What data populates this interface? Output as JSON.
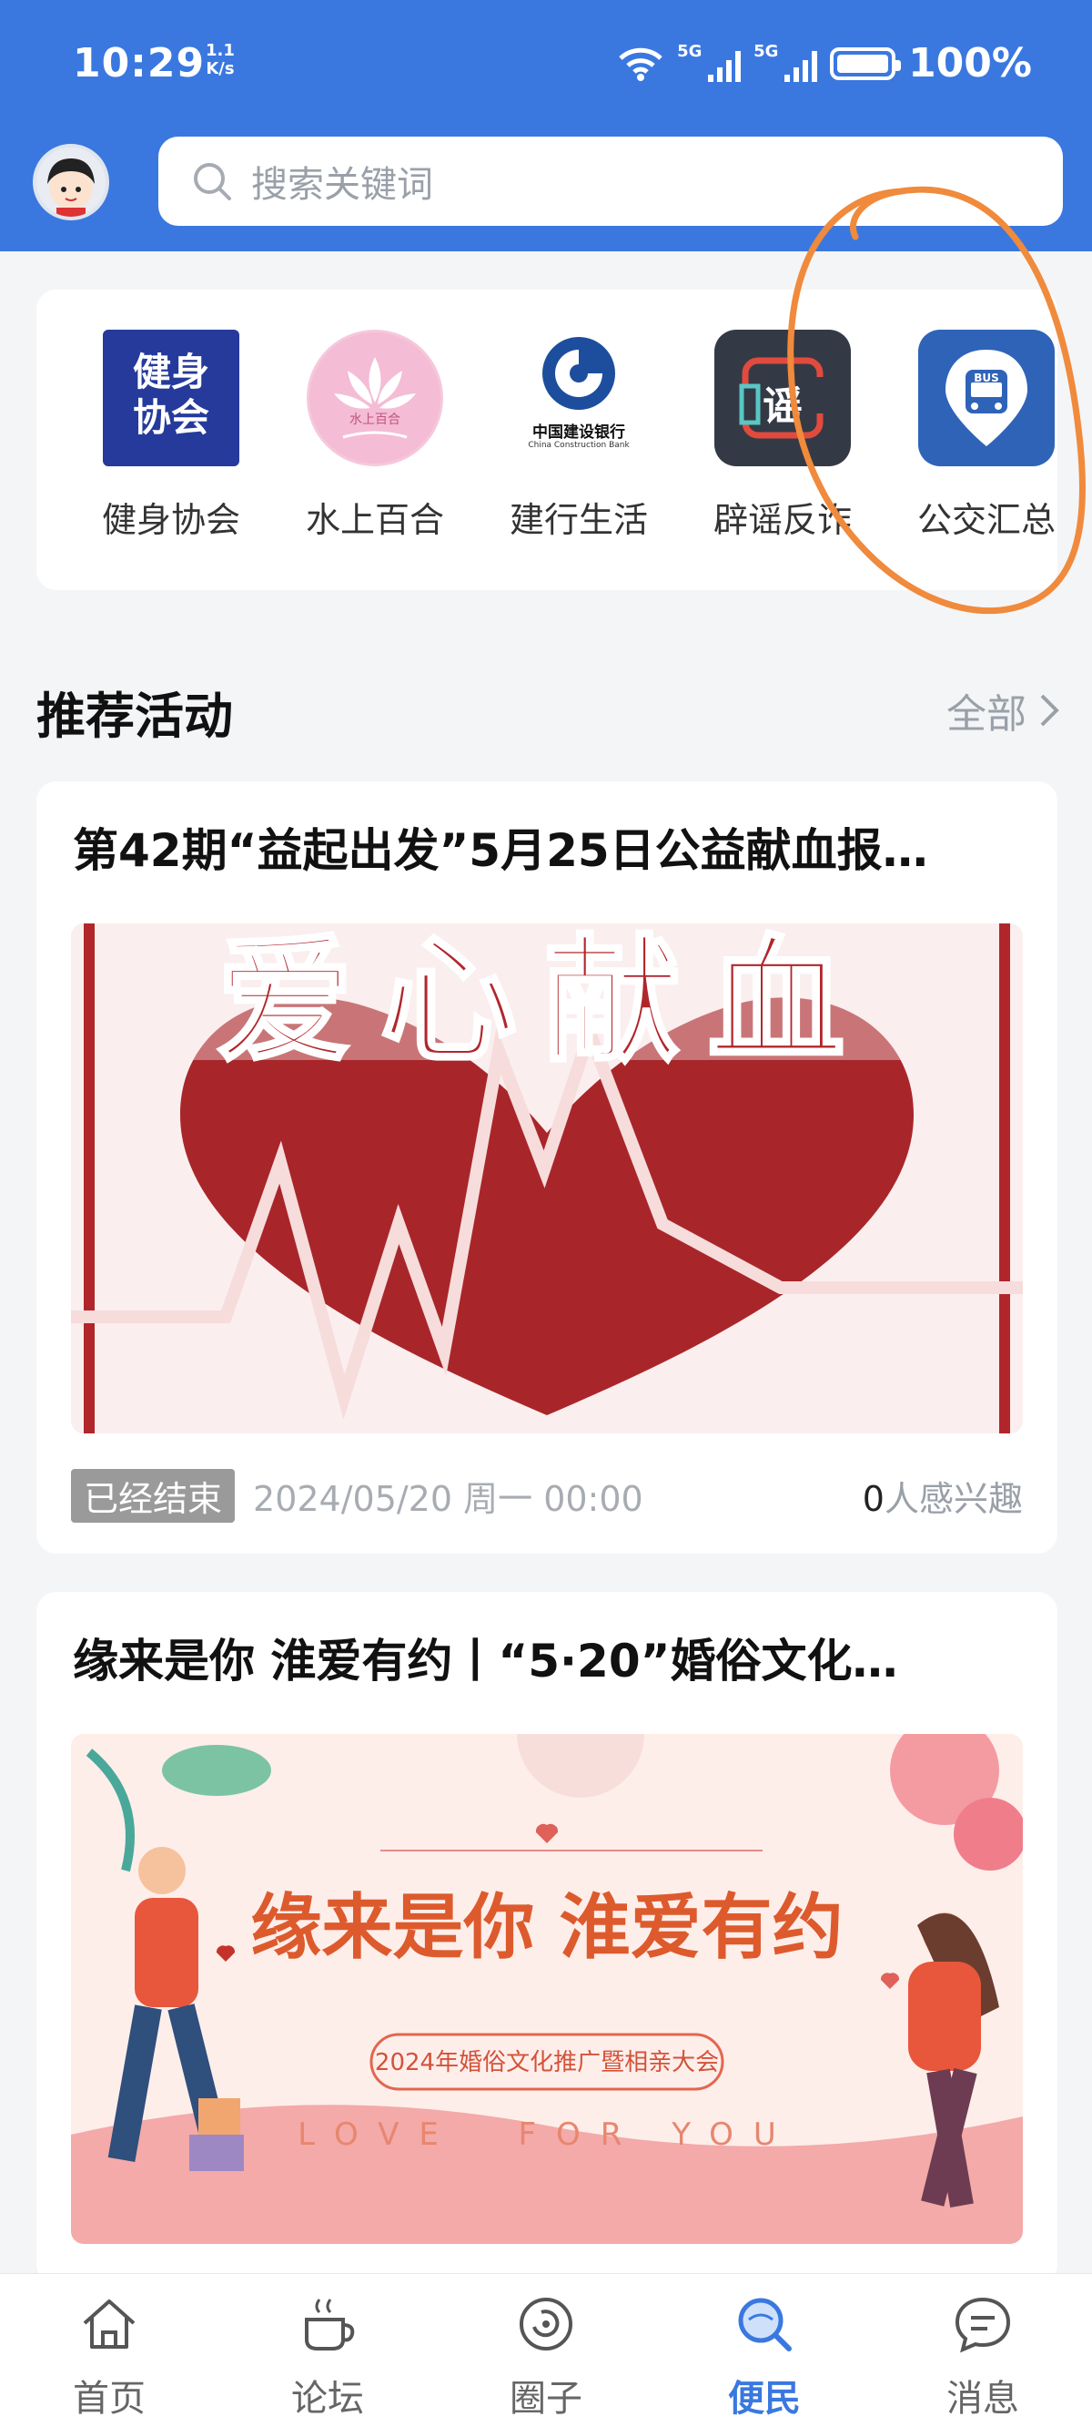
{
  "status": {
    "time": "10:29",
    "speed_top": "1.1",
    "speed_bottom": "K/s",
    "net1": "5G",
    "net2": "5G",
    "battery": "100%"
  },
  "search": {
    "placeholder": "搜索关键词"
  },
  "shortcuts": [
    {
      "label": "健身协会",
      "icon_text": "健身\n协会",
      "icon": "fitness-association-icon"
    },
    {
      "label": "水上百合",
      "icon_text": "水上百合",
      "icon": "water-lily-icon"
    },
    {
      "label": "建行生活",
      "icon_text": "中国建设银行",
      "icon_sub": "China Construction Bank",
      "icon": "ccb-icon"
    },
    {
      "label": "辟谣反诈",
      "icon_text": "谣",
      "icon": "rumor-icon"
    },
    {
      "label": "公交汇总",
      "icon_text": "BUS",
      "icon": "bus-icon"
    }
  ],
  "section": {
    "title": "推荐活动",
    "more": "全部"
  },
  "activities": [
    {
      "title": "第42期“益起出发”5月25日公益献血报…",
      "image_text": "爱心献血",
      "status_tag": "已经结束",
      "date": "2024/05/20 周一 00:00",
      "interest_count": "0",
      "interest_label": "人感兴趣"
    },
    {
      "title": "缘来是你 淮爱有约丨“5·20”婚俗文化…",
      "image_title": "缘来是你 淮爱有约",
      "image_sub": "2024年婚俗文化推广暨相亲大会",
      "image_love": "LOVE  FOR YOU"
    }
  ],
  "nav": [
    {
      "label": "首页",
      "icon": "home-icon"
    },
    {
      "label": "论坛",
      "icon": "coffee-icon"
    },
    {
      "label": "圈子",
      "icon": "circle-icon"
    },
    {
      "label": "便民",
      "icon": "search-globe-icon",
      "active": true
    },
    {
      "label": "消息",
      "icon": "message-icon"
    }
  ],
  "colors": {
    "primary": "#3a78e0",
    "annotation": "#f08a3c",
    "blood": "#b1262b"
  }
}
